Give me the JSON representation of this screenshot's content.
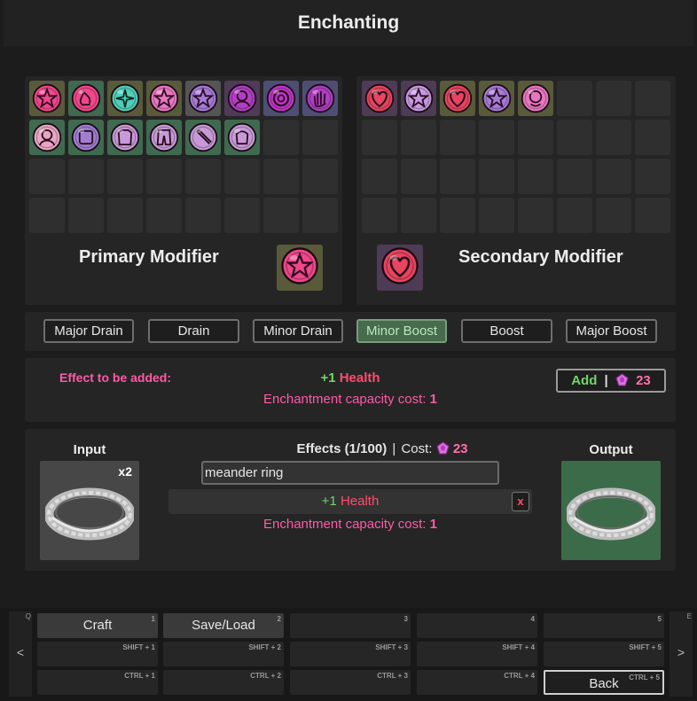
{
  "title": "Enchanting",
  "primary": {
    "label": "Primary Modifier",
    "slots": [
      {
        "bg": "#595a3a",
        "color": "#f0478b",
        "glyph": "star"
      },
      {
        "bg": "#3f6a4f",
        "color": "#f0478b",
        "glyph": "flame"
      },
      {
        "bg": "#595a3a",
        "color": "#4fcfb8",
        "glyph": "sparkle"
      },
      {
        "bg": "#595a3a",
        "color": "#e877c0",
        "glyph": "star"
      },
      {
        "bg": "#555",
        "color": "#a57bd6",
        "glyph": "star"
      },
      {
        "bg": "#4e3b56",
        "color": "#b13ec4",
        "glyph": "head"
      },
      {
        "bg": "#4e4e74",
        "color": "#c235c8",
        "glyph": "ring"
      },
      {
        "bg": "#4e4e74",
        "color": "#b13ec4",
        "glyph": "hand"
      },
      {
        "bg": "#3f6a4f",
        "color": "#e8a6c2",
        "glyph": "head"
      },
      {
        "bg": "#3f6a4f",
        "color": "#a07fd0",
        "glyph": "square"
      },
      {
        "bg": "#3f6a4f",
        "color": "#c79ad7",
        "glyph": "armor"
      },
      {
        "bg": "#3f6a4f",
        "color": "#c79ad7",
        "glyph": "pants"
      },
      {
        "bg": "#3f6a4f",
        "color": "#c79ad7",
        "glyph": "sword"
      },
      {
        "bg": "#3f6a4f",
        "color": "#c79ad7",
        "glyph": "glove"
      }
    ],
    "selected": {
      "bg": "#595a3a",
      "color": "#f0478b",
      "glyph": "star"
    }
  },
  "secondary": {
    "label": "Secondary Modifier",
    "slots": [
      {
        "bg": "#4e3b56",
        "color": "#e8455f",
        "glyph": "heart"
      },
      {
        "bg": "#4e3b56",
        "color": "#c69ae0",
        "glyph": "star"
      },
      {
        "bg": "#595a3a",
        "color": "#e8455f",
        "glyph": "heart"
      },
      {
        "bg": "#595a3a",
        "color": "#a57bd6",
        "glyph": "star"
      },
      {
        "bg": "#595a3a",
        "color": "#e877c0",
        "glyph": "face"
      }
    ],
    "selected": {
      "bg": "#4e3b56",
      "color": "#e8455f",
      "glyph": "heart"
    }
  },
  "tiers": [
    "Major Drain",
    "Drain",
    "Minor Drain",
    "Minor Boost",
    "Boost",
    "Major Boost"
  ],
  "active_tier": "Minor Boost",
  "effect_to_add": {
    "label": "Effect to be added:",
    "amount": "+1",
    "stat": "Health",
    "cost_label": "Enchantment capacity cost:",
    "cost_value": "1",
    "add_label": "Add",
    "add_divider": "|",
    "add_price": "23"
  },
  "craft": {
    "input_label": "Input",
    "input_count": "x2",
    "effects_label": "Effects (1/100)",
    "divider": "|",
    "cost_label": "Cost:",
    "cost_value": "23",
    "search_value": "meander ring",
    "effect_amount": "+1",
    "effect_stat": "Health",
    "remove_label": "x",
    "cost_line_label": "Enchantment capacity cost:",
    "cost_line_value": "1",
    "output_label": "Output"
  },
  "hotbar": {
    "left_key": "Q",
    "right_key": "E",
    "left_arrow": "<",
    "right_arrow": ">",
    "rows": [
      [
        {
          "label": "Craft",
          "key": "1"
        },
        {
          "label": "Save/Load",
          "key": "2"
        },
        {
          "label": "",
          "key": "3"
        },
        {
          "label": "",
          "key": "4"
        },
        {
          "label": "",
          "key": "5"
        }
      ],
      [
        {
          "label": "",
          "key": "SHIFT + 1"
        },
        {
          "label": "",
          "key": "SHIFT + 2"
        },
        {
          "label": "",
          "key": "SHIFT + 3"
        },
        {
          "label": "",
          "key": "SHIFT + 4"
        },
        {
          "label": "",
          "key": "SHIFT + 5"
        }
      ],
      [
        {
          "label": "",
          "key": "CTRL + 1"
        },
        {
          "label": "",
          "key": "CTRL + 2"
        },
        {
          "label": "",
          "key": "CTRL + 3"
        },
        {
          "label": "",
          "key": "CTRL + 4"
        },
        {
          "label": "Back",
          "key": "CTRL + 5"
        }
      ]
    ]
  },
  "colors": {
    "pink_text": "#ff5aa8",
    "green_text": "#71d66c",
    "health_red": "#ff4c6d",
    "active_tier_bg": "#466c4d",
    "output_bg": "#3c6b4a",
    "input_bg": "#474747"
  }
}
